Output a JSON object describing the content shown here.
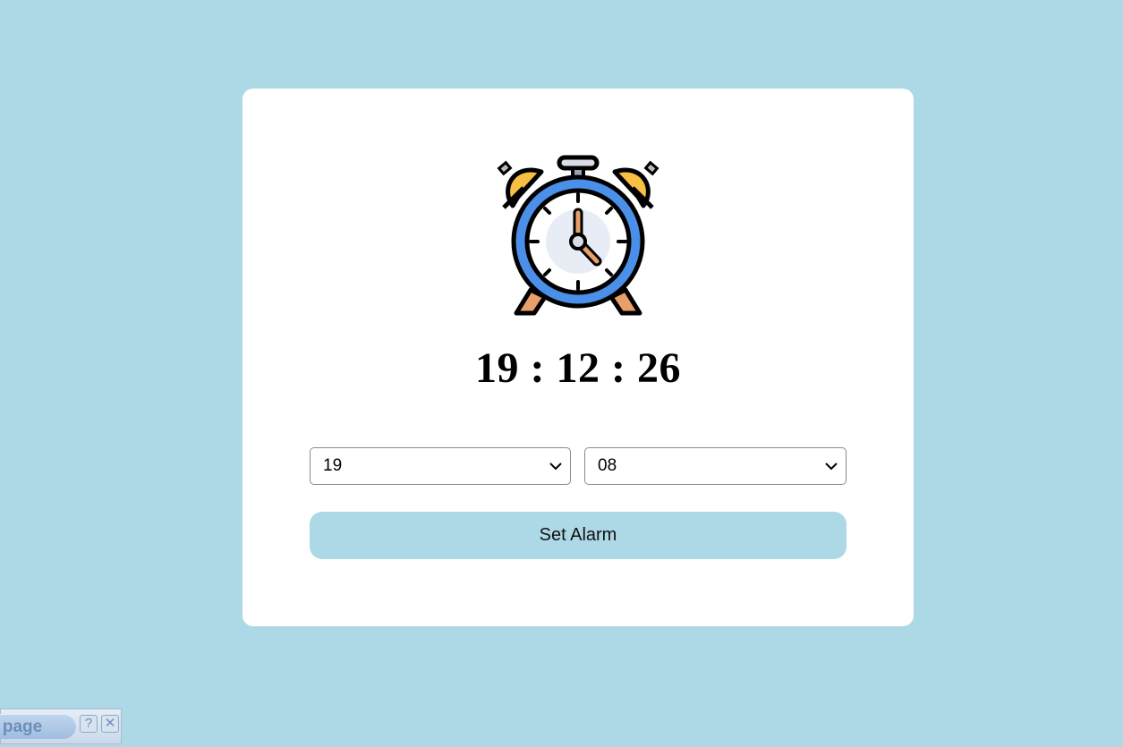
{
  "clock": {
    "time": "19 : 12 : 26"
  },
  "alarm": {
    "hour_value": "19",
    "minute_value": "08",
    "set_label": "Set Alarm"
  },
  "toolbar": {
    "label": "s page",
    "help_label": "?",
    "close_label": "✕"
  },
  "colors": {
    "background": "#add8e6",
    "card": "#ffffff",
    "button": "#add8e6"
  }
}
